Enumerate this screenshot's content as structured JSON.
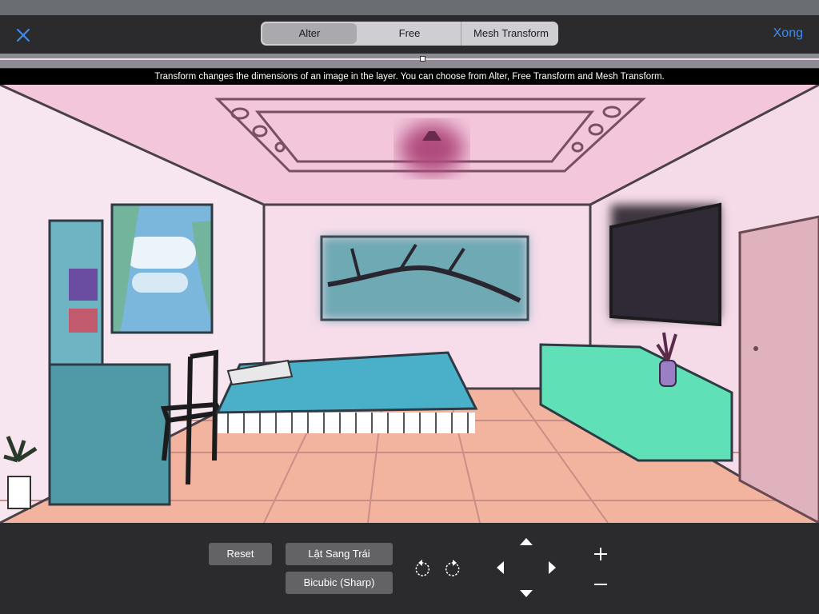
{
  "topbar": {
    "tabs": [
      {
        "label": "Alter",
        "active": true
      },
      {
        "label": "Free",
        "active": false
      },
      {
        "label": "Mesh Transform",
        "active": false
      }
    ],
    "done_label": "Xong",
    "close_icon": "close-icon"
  },
  "hint": {
    "text": "Transform changes the dimensions of an image in the layer. You can choose from Alter, Free Transform and Mesh Transform."
  },
  "controls": {
    "reset_label": "Reset",
    "flip_label": "Lật Sang Trái",
    "interpolation_label": "Bicubic (Sharp)",
    "icons": [
      "rotate-left-icon",
      "rotate-right-icon",
      "arrow-up-icon",
      "arrow-left-icon",
      "arrow-right-icon",
      "arrow-down-icon",
      "zoom-in-icon",
      "zoom-out-icon"
    ]
  },
  "colors": {
    "accent": "#3d8ef0",
    "toolbar_bg": "#2b2b2d",
    "button_bg": "#636366"
  }
}
